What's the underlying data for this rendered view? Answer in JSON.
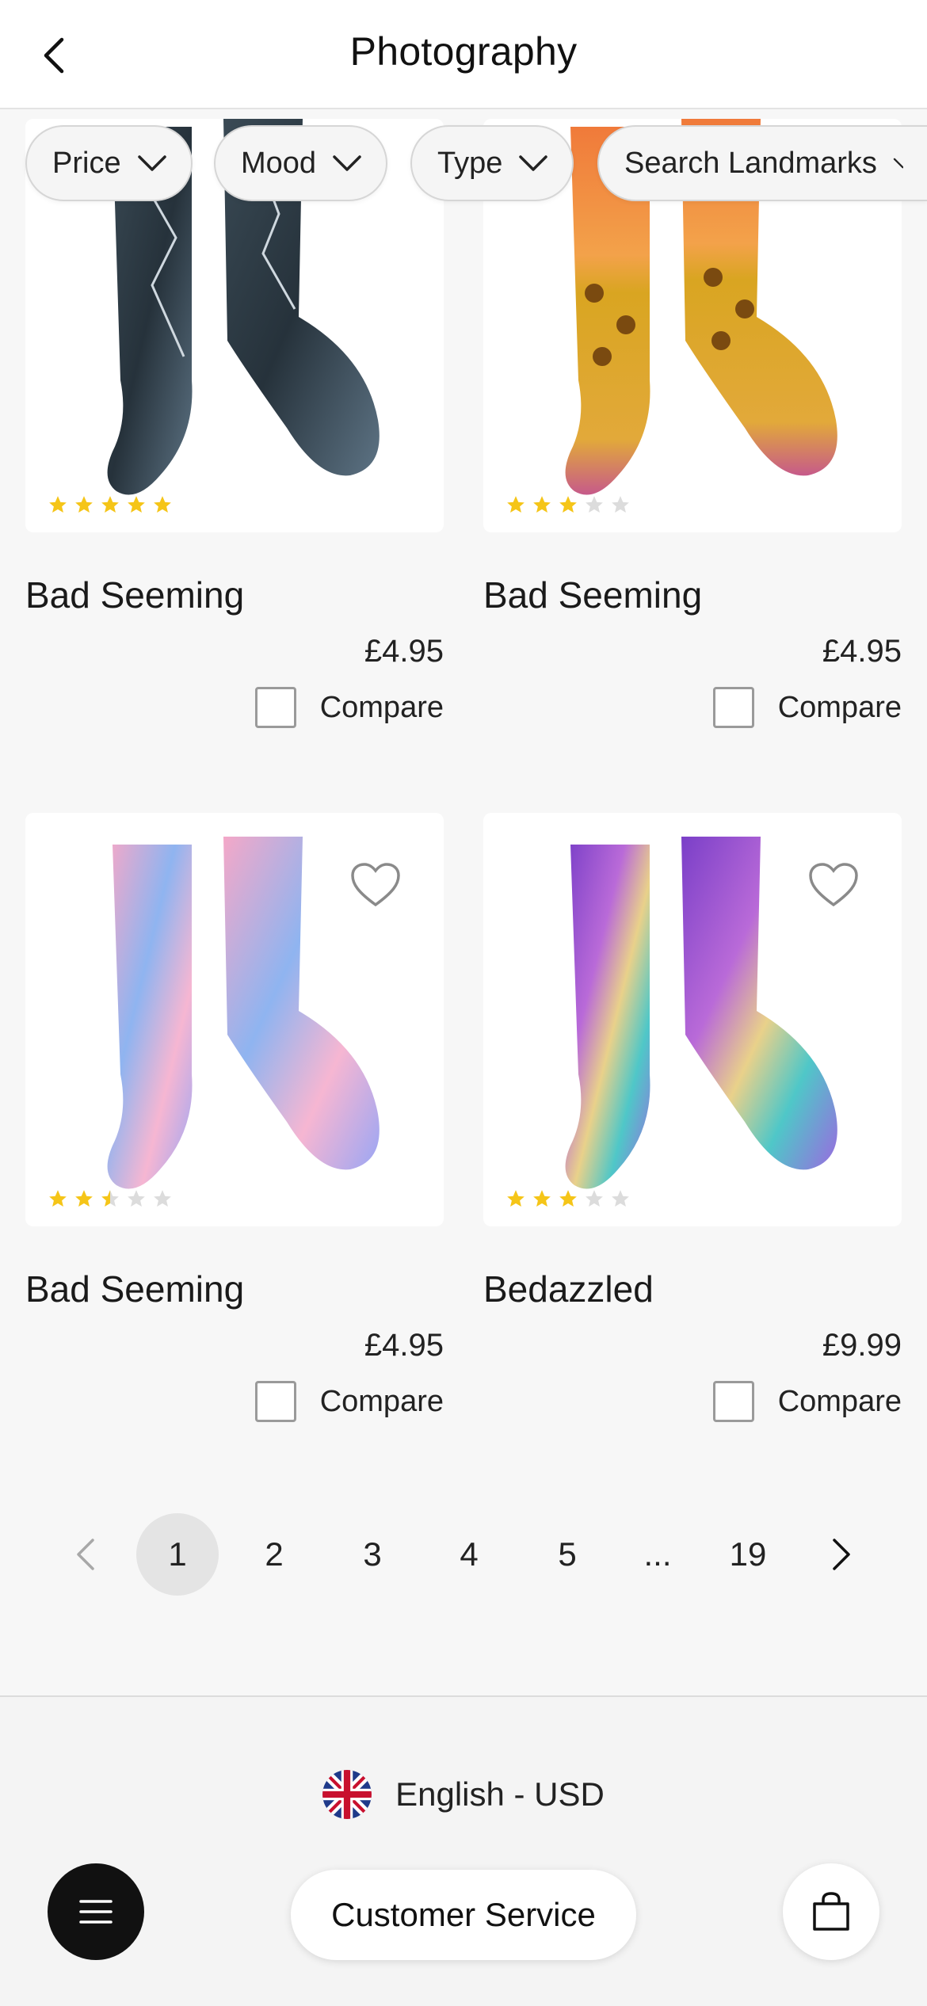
{
  "header": {
    "title": "Photography"
  },
  "filters": [
    {
      "label": "Price"
    },
    {
      "label": "Mood"
    },
    {
      "label": "Type"
    },
    {
      "label": "Search Landmarks"
    }
  ],
  "products": [
    {
      "name": "Bad Seeming",
      "price": "£4.95",
      "rating": 5,
      "compare_label": "Compare",
      "design": "dark-blue-storm"
    },
    {
      "name": "Bad Seeming",
      "price": "£4.95",
      "rating": 3,
      "compare_label": "Compare",
      "design": "sunflower-sunset"
    },
    {
      "name": "Bad Seeming",
      "price": "£4.95",
      "rating": 2.5,
      "compare_label": "Compare",
      "design": "pastel-think-happy"
    },
    {
      "name": "Bedazzled",
      "price": "£9.99",
      "rating": 3,
      "compare_label": "Compare",
      "design": "purple-iridescent-clouds"
    }
  ],
  "pagination": {
    "pages": [
      "1",
      "2",
      "3",
      "4",
      "5",
      "...",
      "19"
    ],
    "current": "1"
  },
  "footer": {
    "language": "English - USD",
    "customer_service": "Customer Service"
  },
  "colors": {
    "star_filled": "#f5c518",
    "star_empty": "#dcdcdc",
    "accent_dark": "#111111"
  }
}
